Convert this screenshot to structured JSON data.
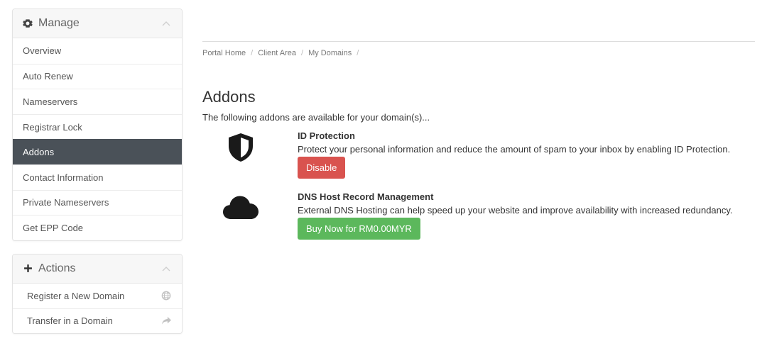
{
  "sidebar": {
    "manage": {
      "title": "Manage",
      "items": [
        {
          "label": "Overview"
        },
        {
          "label": "Auto Renew"
        },
        {
          "label": "Nameservers"
        },
        {
          "label": "Registrar Lock"
        },
        {
          "label": "Addons"
        },
        {
          "label": "Contact Information"
        },
        {
          "label": "Private Nameservers"
        },
        {
          "label": "Get EPP Code"
        }
      ]
    },
    "actions": {
      "title": "Actions",
      "items": [
        {
          "label": "Register a New Domain",
          "icon": "globe-icon"
        },
        {
          "label": "Transfer in a Domain",
          "icon": "share-arrow-icon"
        }
      ]
    }
  },
  "breadcrumb": [
    "Portal Home",
    "Client Area",
    "My Domains"
  ],
  "page": {
    "title": "Addons",
    "intro": "The following addons are available for your domain(s)..."
  },
  "addons": [
    {
      "name": "ID Protection",
      "description": "Protect your personal information and reduce the amount of spam to your inbox by enabling ID Protection.",
      "button": "Disable",
      "icon": "shield-icon"
    },
    {
      "name": "DNS Host Record Management",
      "description": "External DNS Hosting can help speed up your website and improve availability with increased redundancy.",
      "button": "Buy Now for RM0.00MYR",
      "icon": "cloud-icon"
    }
  ],
  "colors": {
    "active_bg": "#4a5158",
    "danger": "#d9534f",
    "success": "#5cb85c"
  }
}
